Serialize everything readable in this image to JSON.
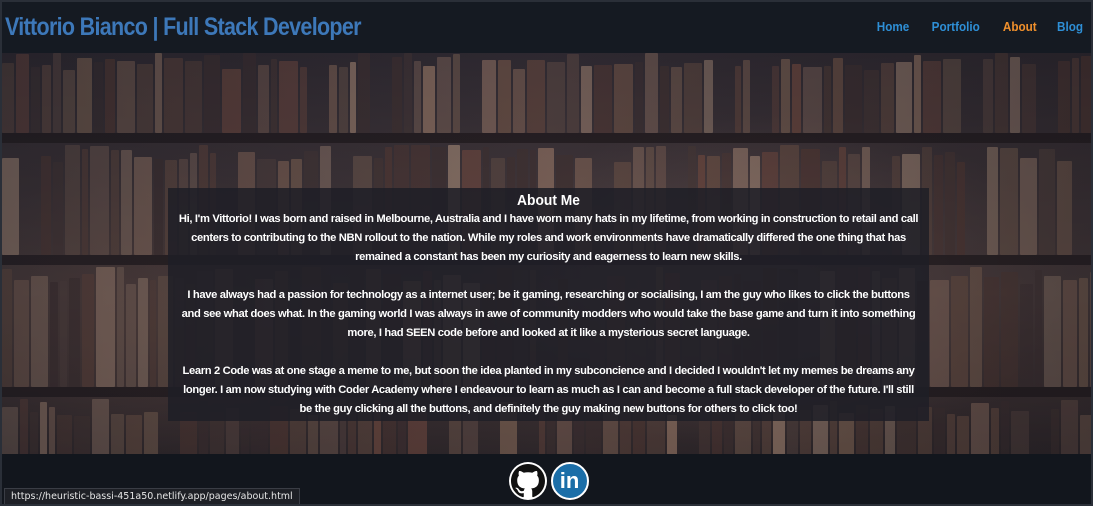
{
  "header": {
    "title": "Vittorio Bianco | Full Stack Developer",
    "nav": [
      {
        "label": "Home",
        "active": false
      },
      {
        "label": "Portfolio",
        "active": false
      },
      {
        "label": "About",
        "active": true
      },
      {
        "label": "Blog",
        "active": false
      }
    ]
  },
  "about": {
    "title": "About Me",
    "paragraphs": [
      "Hi, I'm Vittorio! I was born and raised in Melbourne, Australia and I have worn many hats in my lifetime, from working in construction to retail and call centers to contributing to the NBN rollout to the nation. While my roles and work environments have dramatically differed the one thing that has remained a constant has been my curiosity and eagerness to learn new skills.",
      "I have always had a passion for technology as a internet user; be it gaming, researching or socialising, I am the guy who likes to click the buttons and see what does what. In the gaming world I was always in awe of community modders who would take the base game and turn it into something more, I had SEEN code before and looked at it like a mysterious secret language.",
      "Learn 2 Code was at one stage a meme to me, but soon the idea planted in my subconcience and I decided I wouldn't let my memes be dreams any longer. I am now studying with Coder Academy where I endeavour to learn as much as I can and become a full stack developer of the future. I'll still be the guy clicking all the buttons, and definitely the guy making new buttons for others to click too!"
    ]
  },
  "footer": {
    "icons": [
      "github-icon",
      "linkedin-icon"
    ],
    "linkedin_text": "in"
  },
  "status_bar": {
    "url": "https://heuristic-bassi-451a50.netlify.app/pages/about.html"
  },
  "colors": {
    "title": "#3d78b9",
    "nav": "#2e8fd6",
    "nav_active": "#f0902c",
    "header_bg": "#151a22"
  }
}
